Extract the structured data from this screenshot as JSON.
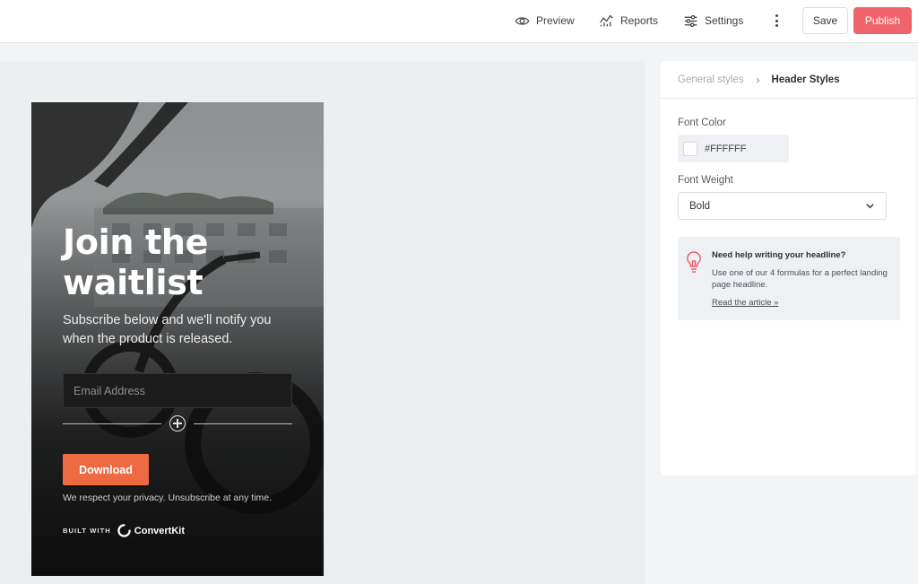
{
  "toolbar": {
    "preview_label": "Preview",
    "reports_label": "Reports",
    "settings_label": "Settings",
    "save_label": "Save",
    "publish_label": "Publish",
    "publish_color": "#f0636b"
  },
  "form": {
    "headline": "Join the waitlist",
    "subtext": "Subscribe below and we'll notify you when the product is released.",
    "email_placeholder": "Email Address",
    "button_label": "Download",
    "button_color": "#ed6a43",
    "privacy_text": "We respect your privacy. Unsubscribe at any time.",
    "built_with_label": "BUILT WITH",
    "brand_name": "ConvertKit"
  },
  "panel": {
    "breadcrumb_parent": "General styles",
    "breadcrumb_current": "Header Styles",
    "font_color_label": "Font Color",
    "font_color_value": "#FFFFFF",
    "font_weight_label": "Font Weight",
    "font_weight_value": "Bold",
    "help": {
      "title": "Need help writing your headline?",
      "text": "Use one of our 4 formulas for a perfect landing page headline.",
      "link": "Read the article »"
    }
  }
}
